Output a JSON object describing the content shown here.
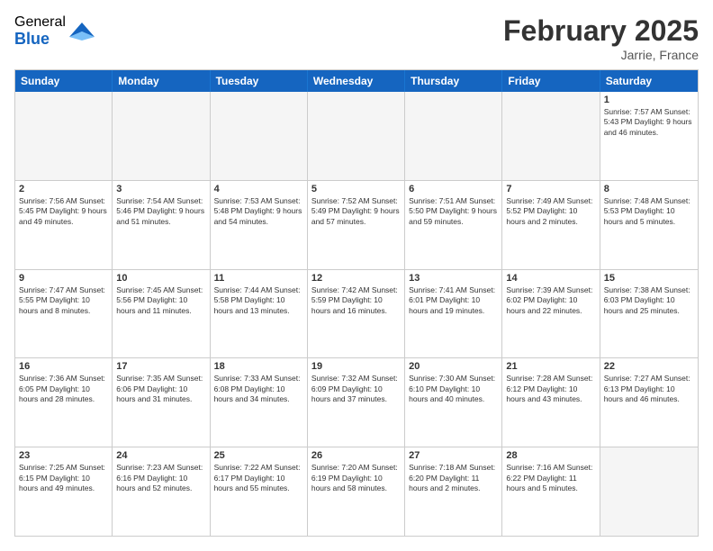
{
  "logo": {
    "general": "General",
    "blue": "Blue"
  },
  "title": "February 2025",
  "location": "Jarrie, France",
  "header_days": [
    "Sunday",
    "Monday",
    "Tuesday",
    "Wednesday",
    "Thursday",
    "Friday",
    "Saturday"
  ],
  "weeks": [
    [
      {
        "day": "",
        "text": "",
        "empty": true
      },
      {
        "day": "",
        "text": "",
        "empty": true
      },
      {
        "day": "",
        "text": "",
        "empty": true
      },
      {
        "day": "",
        "text": "",
        "empty": true
      },
      {
        "day": "",
        "text": "",
        "empty": true
      },
      {
        "day": "",
        "text": "",
        "empty": true
      },
      {
        "day": "1",
        "text": "Sunrise: 7:57 AM\nSunset: 5:43 PM\nDaylight: 9 hours and 46 minutes.",
        "empty": false
      }
    ],
    [
      {
        "day": "2",
        "text": "Sunrise: 7:56 AM\nSunset: 5:45 PM\nDaylight: 9 hours and 49 minutes.",
        "empty": false
      },
      {
        "day": "3",
        "text": "Sunrise: 7:54 AM\nSunset: 5:46 PM\nDaylight: 9 hours and 51 minutes.",
        "empty": false
      },
      {
        "day": "4",
        "text": "Sunrise: 7:53 AM\nSunset: 5:48 PM\nDaylight: 9 hours and 54 minutes.",
        "empty": false
      },
      {
        "day": "5",
        "text": "Sunrise: 7:52 AM\nSunset: 5:49 PM\nDaylight: 9 hours and 57 minutes.",
        "empty": false
      },
      {
        "day": "6",
        "text": "Sunrise: 7:51 AM\nSunset: 5:50 PM\nDaylight: 9 hours and 59 minutes.",
        "empty": false
      },
      {
        "day": "7",
        "text": "Sunrise: 7:49 AM\nSunset: 5:52 PM\nDaylight: 10 hours and 2 minutes.",
        "empty": false
      },
      {
        "day": "8",
        "text": "Sunrise: 7:48 AM\nSunset: 5:53 PM\nDaylight: 10 hours and 5 minutes.",
        "empty": false
      }
    ],
    [
      {
        "day": "9",
        "text": "Sunrise: 7:47 AM\nSunset: 5:55 PM\nDaylight: 10 hours and 8 minutes.",
        "empty": false
      },
      {
        "day": "10",
        "text": "Sunrise: 7:45 AM\nSunset: 5:56 PM\nDaylight: 10 hours and 11 minutes.",
        "empty": false
      },
      {
        "day": "11",
        "text": "Sunrise: 7:44 AM\nSunset: 5:58 PM\nDaylight: 10 hours and 13 minutes.",
        "empty": false
      },
      {
        "day": "12",
        "text": "Sunrise: 7:42 AM\nSunset: 5:59 PM\nDaylight: 10 hours and 16 minutes.",
        "empty": false
      },
      {
        "day": "13",
        "text": "Sunrise: 7:41 AM\nSunset: 6:01 PM\nDaylight: 10 hours and 19 minutes.",
        "empty": false
      },
      {
        "day": "14",
        "text": "Sunrise: 7:39 AM\nSunset: 6:02 PM\nDaylight: 10 hours and 22 minutes.",
        "empty": false
      },
      {
        "day": "15",
        "text": "Sunrise: 7:38 AM\nSunset: 6:03 PM\nDaylight: 10 hours and 25 minutes.",
        "empty": false
      }
    ],
    [
      {
        "day": "16",
        "text": "Sunrise: 7:36 AM\nSunset: 6:05 PM\nDaylight: 10 hours and 28 minutes.",
        "empty": false
      },
      {
        "day": "17",
        "text": "Sunrise: 7:35 AM\nSunset: 6:06 PM\nDaylight: 10 hours and 31 minutes.",
        "empty": false
      },
      {
        "day": "18",
        "text": "Sunrise: 7:33 AM\nSunset: 6:08 PM\nDaylight: 10 hours and 34 minutes.",
        "empty": false
      },
      {
        "day": "19",
        "text": "Sunrise: 7:32 AM\nSunset: 6:09 PM\nDaylight: 10 hours and 37 minutes.",
        "empty": false
      },
      {
        "day": "20",
        "text": "Sunrise: 7:30 AM\nSunset: 6:10 PM\nDaylight: 10 hours and 40 minutes.",
        "empty": false
      },
      {
        "day": "21",
        "text": "Sunrise: 7:28 AM\nSunset: 6:12 PM\nDaylight: 10 hours and 43 minutes.",
        "empty": false
      },
      {
        "day": "22",
        "text": "Sunrise: 7:27 AM\nSunset: 6:13 PM\nDaylight: 10 hours and 46 minutes.",
        "empty": false
      }
    ],
    [
      {
        "day": "23",
        "text": "Sunrise: 7:25 AM\nSunset: 6:15 PM\nDaylight: 10 hours and 49 minutes.",
        "empty": false
      },
      {
        "day": "24",
        "text": "Sunrise: 7:23 AM\nSunset: 6:16 PM\nDaylight: 10 hours and 52 minutes.",
        "empty": false
      },
      {
        "day": "25",
        "text": "Sunrise: 7:22 AM\nSunset: 6:17 PM\nDaylight: 10 hours and 55 minutes.",
        "empty": false
      },
      {
        "day": "26",
        "text": "Sunrise: 7:20 AM\nSunset: 6:19 PM\nDaylight: 10 hours and 58 minutes.",
        "empty": false
      },
      {
        "day": "27",
        "text": "Sunrise: 7:18 AM\nSunset: 6:20 PM\nDaylight: 11 hours and 2 minutes.",
        "empty": false
      },
      {
        "day": "28",
        "text": "Sunrise: 7:16 AM\nSunset: 6:22 PM\nDaylight: 11 hours and 5 minutes.",
        "empty": false
      },
      {
        "day": "",
        "text": "",
        "empty": true
      }
    ]
  ]
}
